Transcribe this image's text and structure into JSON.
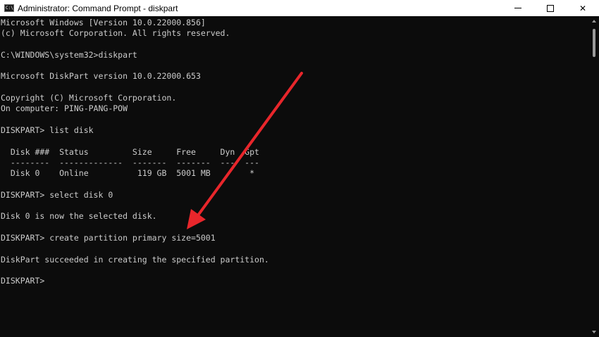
{
  "window": {
    "title": "Administrator: Command Prompt - diskpart",
    "icon": "cmd-icon",
    "icon_glyph": "C:\\"
  },
  "controls": {
    "minimize_icon": "minimize-icon",
    "maximize_icon": "maximize-icon",
    "close_glyph": "✕"
  },
  "terminal": {
    "lines": [
      "Microsoft Windows [Version 10.0.22000.856]",
      "(c) Microsoft Corporation. All rights reserved.",
      "",
      "C:\\WINDOWS\\system32>diskpart",
      "",
      "Microsoft DiskPart version 10.0.22000.653",
      "",
      "Copyright (C) Microsoft Corporation.",
      "On computer: PING-PANG-POW",
      "",
      "DISKPART> list disk",
      "",
      "  Disk ###  Status         Size     Free     Dyn  Gpt",
      "  --------  -------------  -------  -------  ---  ---",
      "  Disk 0    Online          119 GB  5001 MB        *",
      "",
      "DISKPART> select disk 0",
      "",
      "Disk 0 is now the selected disk.",
      "",
      "DISKPART> create partition primary size=5001",
      "",
      "DiskPart succeeded in creating the specified partition.",
      "",
      "DISKPART> "
    ]
  },
  "annotation": {
    "arrow_color": "#e8262b",
    "icon": "red-arrow-icon"
  },
  "colors": {
    "terminal_bg": "#0c0c0c",
    "terminal_text": "#cccccc",
    "titlebar_bg": "#ffffff"
  }
}
